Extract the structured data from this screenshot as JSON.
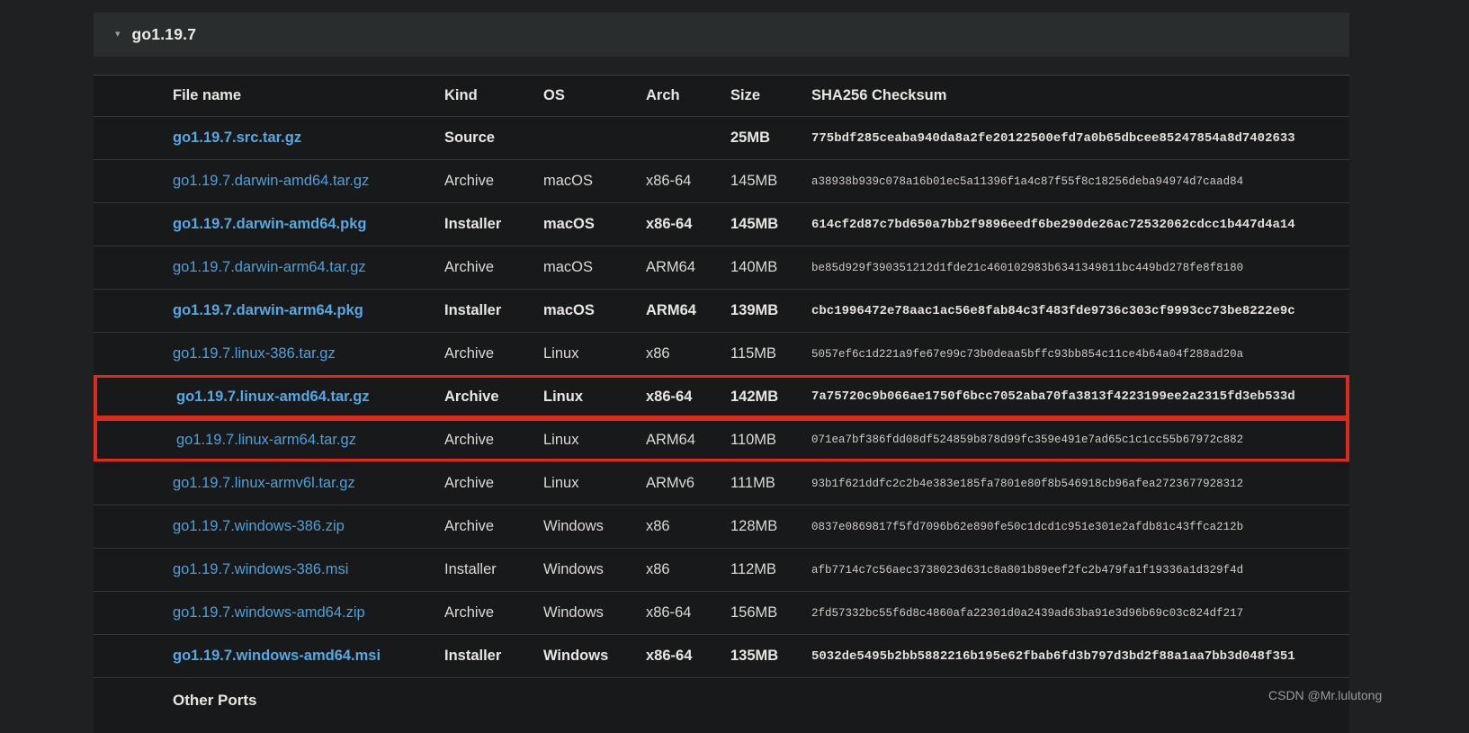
{
  "release": {
    "title": "go1.19.7",
    "caret_icon": "▾"
  },
  "table": {
    "columns": [
      "File name",
      "Kind",
      "OS",
      "Arch",
      "Size",
      "SHA256 Checksum"
    ],
    "rows": [
      {
        "file": "go1.19.7.src.tar.gz",
        "kind": "Source",
        "os": "",
        "arch": "",
        "size": "25MB",
        "sha256": "775bdf285ceaba940da8a2fe20122500efd7a0b65dbcee85247854a8d7402633",
        "highlight": true,
        "outlined": false
      },
      {
        "file": "go1.19.7.darwin-amd64.tar.gz",
        "kind": "Archive",
        "os": "macOS",
        "arch": "x86-64",
        "size": "145MB",
        "sha256": "a38938b939c078a16b01ec5a11396f1a4c87f55f8c18256deba94974d7caad84",
        "highlight": false,
        "outlined": false
      },
      {
        "file": "go1.19.7.darwin-amd64.pkg",
        "kind": "Installer",
        "os": "macOS",
        "arch": "x86-64",
        "size": "145MB",
        "sha256": "614cf2d87c7bd650a7bb2f9896eedf6be290de26ac72532062cdcc1b447d4a14",
        "highlight": true,
        "outlined": false
      },
      {
        "file": "go1.19.7.darwin-arm64.tar.gz",
        "kind": "Archive",
        "os": "macOS",
        "arch": "ARM64",
        "size": "140MB",
        "sha256": "be85d929f390351212d1fde21c460102983b6341349811bc449bd278fe8f8180",
        "highlight": false,
        "outlined": false
      },
      {
        "file": "go1.19.7.darwin-arm64.pkg",
        "kind": "Installer",
        "os": "macOS",
        "arch": "ARM64",
        "size": "139MB",
        "sha256": "cbc1996472e78aac1ac56e8fab84c3f483fde9736c303cf9993cc73be8222e9c",
        "highlight": true,
        "outlined": false
      },
      {
        "file": "go1.19.7.linux-386.tar.gz",
        "kind": "Archive",
        "os": "Linux",
        "arch": "x86",
        "size": "115MB",
        "sha256": "5057ef6c1d221a9fe67e99c73b0deaa5bffc93bb854c11ce4b64a04f288ad20a",
        "highlight": false,
        "outlined": false
      },
      {
        "file": "go1.19.7.linux-amd64.tar.gz",
        "kind": "Archive",
        "os": "Linux",
        "arch": "x86-64",
        "size": "142MB",
        "sha256": "7a75720c9b066ae1750f6bcc7052aba70fa3813f4223199ee2a2315fd3eb533d",
        "highlight": true,
        "outlined": true
      },
      {
        "file": "go1.19.7.linux-arm64.tar.gz",
        "kind": "Archive",
        "os": "Linux",
        "arch": "ARM64",
        "size": "110MB",
        "sha256": "071ea7bf386fdd08df524859b878d99fc359e491e7ad65c1c1cc55b67972c882",
        "highlight": false,
        "outlined": true
      },
      {
        "file": "go1.19.7.linux-armv6l.tar.gz",
        "kind": "Archive",
        "os": "Linux",
        "arch": "ARMv6",
        "size": "111MB",
        "sha256": "93b1f621ddfc2c2b4e383e185fa7801e80f8b546918cb96afea2723677928312",
        "highlight": false,
        "outlined": false
      },
      {
        "file": "go1.19.7.windows-386.zip",
        "kind": "Archive",
        "os": "Windows",
        "arch": "x86",
        "size": "128MB",
        "sha256": "0837e0869817f5fd7096b62e890fe50c1dcd1c951e301e2afdb81c43ffca212b",
        "highlight": false,
        "outlined": false
      },
      {
        "file": "go1.19.7.windows-386.msi",
        "kind": "Installer",
        "os": "Windows",
        "arch": "x86",
        "size": "112MB",
        "sha256": "afb7714c7c56aec3738023d631c8a801b89eef2fc2b479fa1f19336a1d329f4d",
        "highlight": false,
        "outlined": false
      },
      {
        "file": "go1.19.7.windows-amd64.zip",
        "kind": "Archive",
        "os": "Windows",
        "arch": "x86-64",
        "size": "156MB",
        "sha256": "2fd57332bc55f6d8c4860afa22301d0a2439ad63ba91e3d96b69c03c824df217",
        "highlight": false,
        "outlined": false
      },
      {
        "file": "go1.19.7.windows-amd64.msi",
        "kind": "Installer",
        "os": "Windows",
        "arch": "x86-64",
        "size": "135MB",
        "sha256": "5032de5495b2bb5882216b195e62fbab6fd3b797d3bd2f88a1aa7bb3d048f351",
        "highlight": true,
        "outlined": false
      }
    ],
    "footer_label": "Other Ports"
  },
  "watermark": "CSDN @Mr.lulutong",
  "colors": {
    "accent_link": "#4ba2da",
    "accent_link_bold": "#54a9e2",
    "outline_red": "#dd2a1e",
    "watermark_gray": "#9b9b9b",
    "page_bg": "#1e2021",
    "table_bg": "#17191a",
    "bar_bg": "#2a2d2e",
    "text_main": "#e8e6e3"
  }
}
